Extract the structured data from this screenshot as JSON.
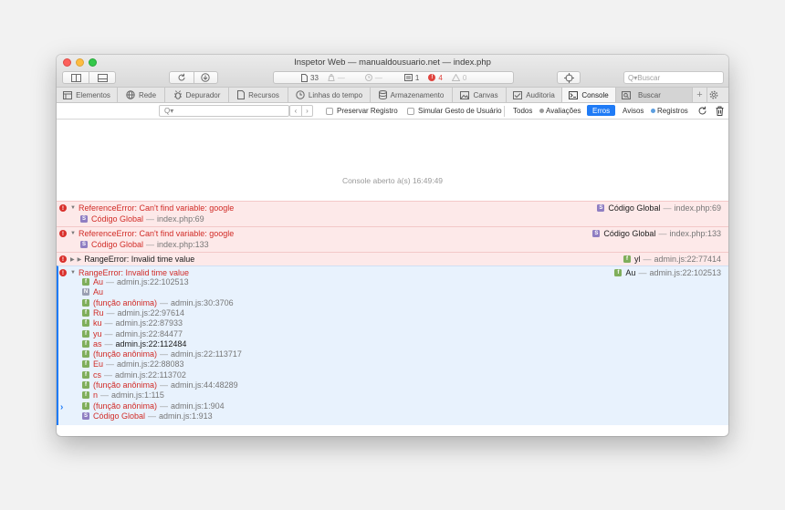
{
  "window": {
    "title": "Inspetor Web — manualdousuario.net — index.php"
  },
  "toolbar": {
    "dashboard": {
      "resources_count": "33",
      "resources_size": "—",
      "load_time": "—",
      "logs": "1",
      "errors": "4",
      "warnings": "0"
    },
    "search_placeholder": "Buscar"
  },
  "tabs": [
    {
      "label": "Elementos",
      "icon": "elements-icon"
    },
    {
      "label": "Rede",
      "icon": "network-icon"
    },
    {
      "label": "Depurador",
      "icon": "debugger-icon"
    },
    {
      "label": "Recursos",
      "icon": "resources-icon"
    },
    {
      "label": "Linhas do tempo",
      "icon": "timelines-icon"
    },
    {
      "label": "Armazenamento",
      "icon": "storage-icon"
    },
    {
      "label": "Canvas",
      "icon": "canvas-icon"
    },
    {
      "label": "Auditoria",
      "icon": "audit-icon"
    },
    {
      "label": "Console",
      "icon": "console-icon",
      "active": true
    },
    {
      "label": "Buscar",
      "icon": "search-icon"
    }
  ],
  "filterbar": {
    "preserve_log": "Preservar Registro",
    "emulate_gesture": "Simular Gesto de Usuário",
    "filters": {
      "all": "Todos",
      "evaluations": "Avaliações",
      "errors": "Erros",
      "warnings": "Avisos",
      "logs": "Registros"
    }
  },
  "console": {
    "opened_text": "Console aberto à(s) 16:49:49",
    "messages": [
      {
        "text": "ReferenceError: Can't find variable: google",
        "source_label": "Código Global",
        "source_file": "index.php:69",
        "frame_label": "Código Global",
        "frame_file": "index.php:69"
      },
      {
        "text": "ReferenceError: Can't find variable: google",
        "source_label": "Código Global",
        "source_file": "index.php:133",
        "frame_label": "Código Global",
        "frame_file": "index.php:133"
      },
      {
        "text": "RangeError: Invalid time value",
        "source_label": "yl",
        "source_file": "admin.js:22:77414"
      },
      {
        "text": "RangeError: Invalid time value",
        "source_label": "Au",
        "source_file": "admin.js:22:102513",
        "frames": [
          {
            "badge": "f",
            "name": "Au",
            "loc": "admin.js:22:102513"
          },
          {
            "badge": "N",
            "name": "Au",
            "loc": ""
          },
          {
            "badge": "f",
            "name": "(função anônima)",
            "loc": "admin.js:30:3706"
          },
          {
            "badge": "f",
            "name": "Ru",
            "loc": "admin.js:22:97614"
          },
          {
            "badge": "f",
            "name": "ku",
            "loc": "admin.js:22:87933"
          },
          {
            "badge": "f",
            "name": "yu",
            "loc": "admin.js:22:84477"
          },
          {
            "badge": "f",
            "name": "as",
            "loc": "admin.js:22:112484"
          },
          {
            "badge": "f",
            "name": "(função anônima)",
            "loc": "admin.js:22:113717"
          },
          {
            "badge": "f",
            "name": "Eu",
            "loc": "admin.js:22:88083"
          },
          {
            "badge": "f",
            "name": "cs",
            "loc": "admin.js:22:113702"
          },
          {
            "badge": "f",
            "name": "(função anônima)",
            "loc": "admin.js:44:48289"
          },
          {
            "badge": "f",
            "name": "n",
            "loc": "admin.js:1:115"
          },
          {
            "badge": "f",
            "name": "(função anônima)",
            "loc": "admin.js:1:904"
          },
          {
            "badge": "S",
            "name": "Código Global",
            "loc": "admin.js:1:913"
          }
        ]
      }
    ],
    "prompt_symbol": "›"
  },
  "colors": {
    "error": "#d12c27",
    "accent": "#1f7bf6",
    "error_bg": "#fde9e9",
    "selected_bg": "#e8f2fd"
  }
}
